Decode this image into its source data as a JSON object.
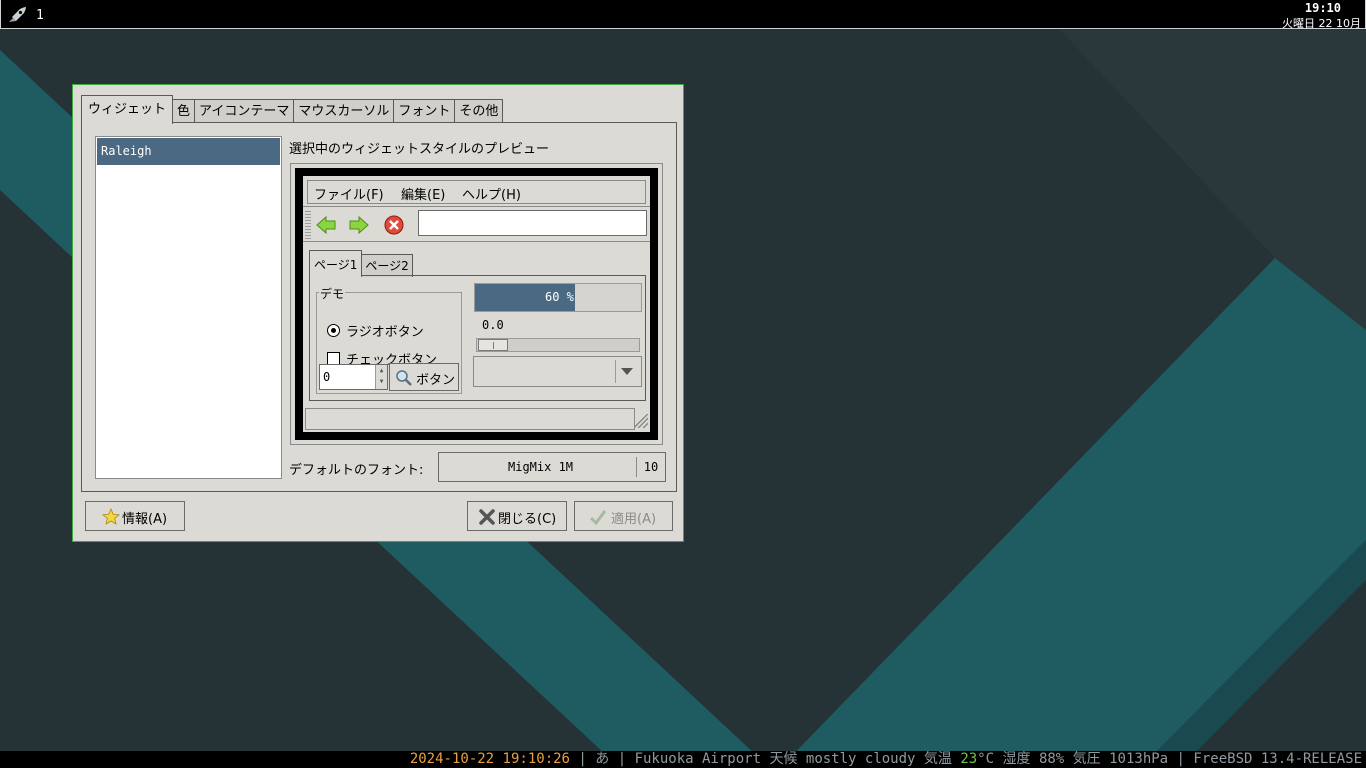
{
  "panel": {
    "workspace": "1",
    "time": "19:10",
    "date": "火曜日 22 10月"
  },
  "status": {
    "datetime": "2024-10-22 19:10:26",
    "ime": "あ",
    "location": "Fukuoka Airport",
    "weather_label": "天候",
    "weather": "mostly cloudy",
    "temp_label": "気温",
    "temp_value": "23",
    "temp_unit": "°C",
    "humidity_label": "湿度",
    "humidity": "88%",
    "pressure_label": "気圧",
    "pressure": "1013hPa",
    "os": "FreeBSD 13.4-RELEASE"
  },
  "dialog": {
    "tabs": [
      "ウィジェット",
      "色",
      "アイコンテーマ",
      "マウスカーソル",
      "フォント",
      "その他"
    ],
    "active_tab": 0,
    "themes": [
      "Raleigh"
    ],
    "preview_label": "選択中のウィジェットスタイルのプレビュー",
    "preview": {
      "menu": [
        "ファイル(F)",
        "編集(E)",
        "ヘルプ(H)"
      ],
      "tabs": [
        "ページ1",
        "ページ2"
      ],
      "frame_title": "デモ",
      "radio_label": "ラジオボタン",
      "check_label": "チェックボタン",
      "spin_value": "0",
      "button_label": "ボタン",
      "progress_label": "60 %",
      "progress_fraction": 0.6,
      "scale_value": "0.0"
    },
    "font_label": "デフォルトのフォント:",
    "font_name": "MigMix 1M",
    "font_size": "10",
    "about_label": "情報(A)",
    "close_label": "閉じる(C)",
    "apply_label": "適用(A)"
  },
  "colors": {
    "selection": "#4b6983",
    "window_border": "#3ea83e",
    "desktop_teal": "#1f5a60"
  }
}
